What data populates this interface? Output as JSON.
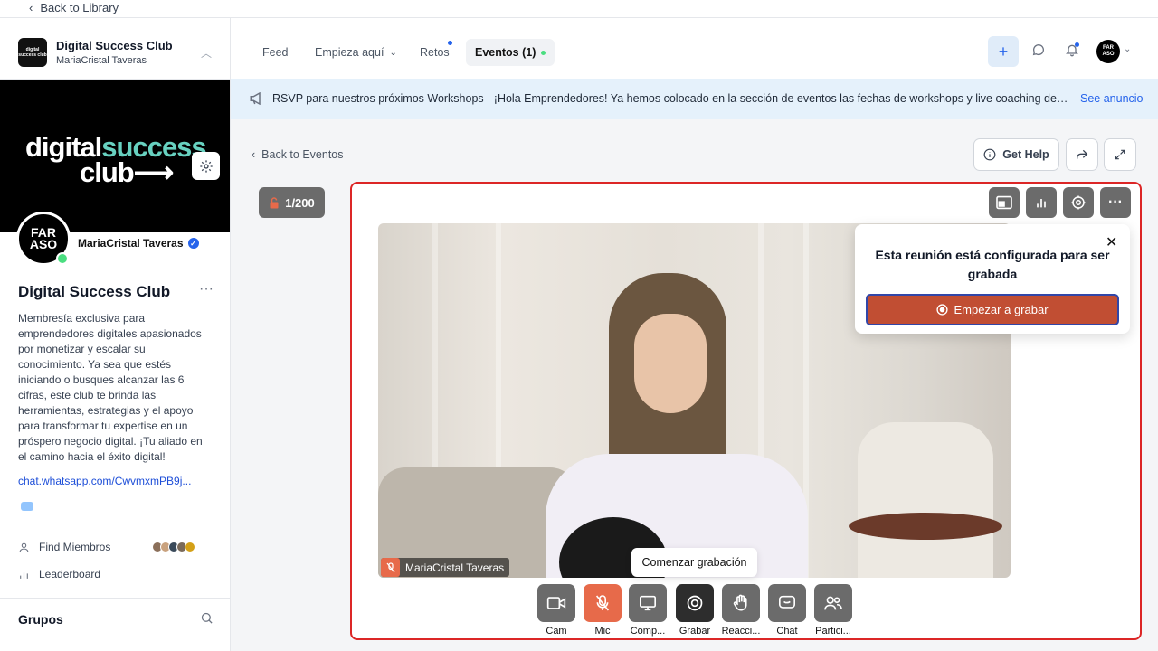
{
  "topbar": {
    "back_library": "Back to Library"
  },
  "sidebar": {
    "club_name": "Digital Success Club",
    "club_owner": "MariaCristal Taveras",
    "club_logo_text": "digital success club",
    "banner_line1a": "digital",
    "banner_line1b": "success",
    "banner_line2": "club⟶",
    "avatar_text": "FAR ASO",
    "owner_name": "MariaCristal Taveras",
    "group_title": "Digital Success Club",
    "group_more": "···",
    "description": "Membresía exclusiva para emprendedores digitales apasionados por monetizar y escalar su conocimiento. Ya sea que estés iniciando o busques alcanzar las 6 cifras, este club te brinda las herramientas, estrategias y el apoyo para transformar tu expertise en un próspero negocio digital. ¡Tu aliado en el camino hacia el éxito digital!",
    "whatsapp_link": "chat.whatsapp.com/CwvmxmPB9j...",
    "find_members": "Find Miembros",
    "leaderboard": "Leaderboard",
    "groups": "Grupos"
  },
  "nav": {
    "tabs": [
      {
        "label": "Feed"
      },
      {
        "label": "Empieza aquí"
      },
      {
        "label": "Retos"
      },
      {
        "label": "Eventos (1)"
      }
    ],
    "avatar_text": "FAR ASO"
  },
  "announcement": {
    "text": "RSVP para nuestros próximos Workshops - ¡Hola Emprendedores! Ya hemos colocado en la sección de eventos las fechas de workshops y live coaching de abril, ma...",
    "link": "See anuncio"
  },
  "event": {
    "back": "Back to Eventos",
    "get_help": "Get Help",
    "counter": "1/200",
    "participant_name": "MariaCristal Taveras",
    "record_popup_title": "Esta reunión está configurada para ser grabada",
    "record_popup_button": "Empezar a grabar",
    "tooltip": "Comenzar grabación"
  },
  "controls": [
    {
      "label": "Cam"
    },
    {
      "label": "Mic"
    },
    {
      "label": "Comp..."
    },
    {
      "label": "Grabar"
    },
    {
      "label": "Reacci..."
    },
    {
      "label": "Chat"
    },
    {
      "label": "Partici..."
    }
  ],
  "colors": {
    "accent": "#2563eb",
    "record": "#c14e33",
    "frame": "#dc2626",
    "mic_muted": "#e76a4a"
  }
}
